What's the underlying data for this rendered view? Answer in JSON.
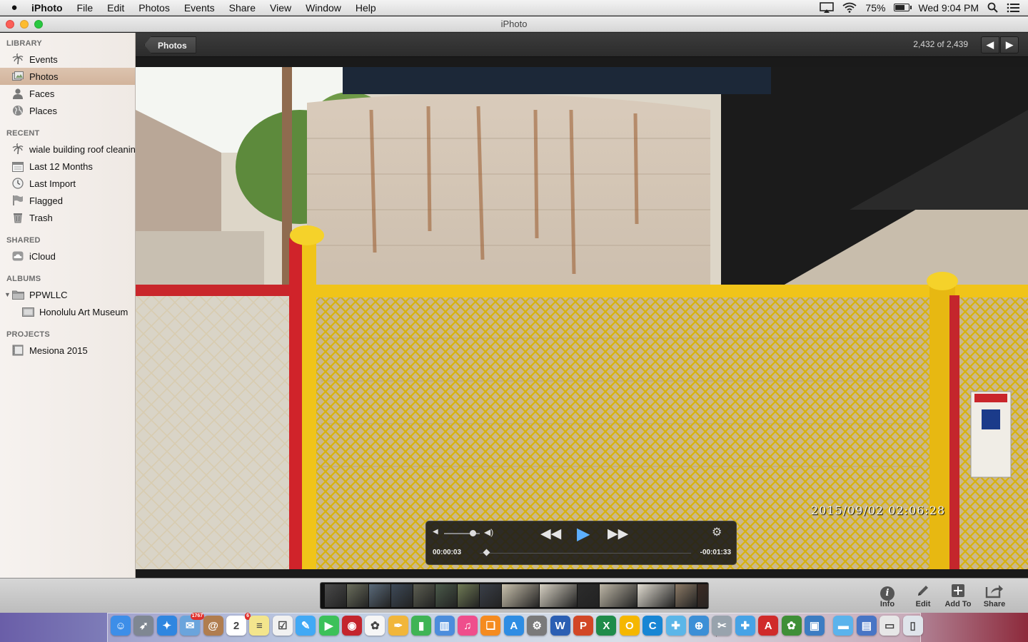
{
  "menubar": {
    "apple_icon": "apple-logo-icon",
    "items": [
      "iPhoto",
      "File",
      "Edit",
      "Photos",
      "Events",
      "Share",
      "View",
      "Window",
      "Help"
    ],
    "battery_percent": "75%",
    "battery_level": 0.75,
    "clock": "Wed 9:04 PM"
  },
  "window": {
    "title": "iPhoto"
  },
  "sidebar": {
    "sections": [
      {
        "header": "LIBRARY",
        "items": [
          {
            "label": "Events",
            "icon": "palm-tree-icon"
          },
          {
            "label": "Photos",
            "icon": "photos-icon",
            "selected": true
          },
          {
            "label": "Faces",
            "icon": "person-icon"
          },
          {
            "label": "Places",
            "icon": "globe-icon"
          }
        ]
      },
      {
        "header": "RECENT",
        "items": [
          {
            "label": "wiale building roof cleaning",
            "icon": "palm-tree-icon"
          },
          {
            "label": "Last 12 Months",
            "icon": "calendar-icon"
          },
          {
            "label": "Last Import",
            "icon": "clock-icon"
          },
          {
            "label": "Flagged",
            "icon": "flag-icon"
          },
          {
            "label": "Trash",
            "icon": "trash-icon"
          }
        ]
      },
      {
        "header": "SHARED",
        "items": [
          {
            "label": "iCloud",
            "icon": "icloud-icon"
          }
        ]
      },
      {
        "header": "ALBUMS",
        "items": [
          {
            "label": "PPWLLC",
            "icon": "folder-icon",
            "expanded": true
          },
          {
            "label": "Honolulu Art Museum",
            "icon": "album-icon",
            "indent": true
          }
        ]
      },
      {
        "header": "PROJECTS",
        "items": [
          {
            "label": "Mesiona 2015",
            "icon": "book-icon"
          }
        ]
      }
    ]
  },
  "toolbar": {
    "back_label": "Photos",
    "counter": "2,432 of 2,439",
    "prev_icon": "arrow-left-icon",
    "next_icon": "arrow-right-icon"
  },
  "viewer": {
    "timestamp": "2015/09/02  02:06:28",
    "hud": {
      "elapsed": "00:00:03",
      "remaining": "-00:01:33",
      "volume_level": 0.8,
      "playback_progress": 0.03
    }
  },
  "bottombar": {
    "buttons": [
      {
        "label": "Info",
        "icon": "info-icon"
      },
      {
        "label": "Edit",
        "icon": "pencil-icon"
      },
      {
        "label": "Add To",
        "icon": "plus-icon"
      },
      {
        "label": "Share",
        "icon": "share-icon"
      }
    ],
    "filmstrip_count": 16,
    "filmstrip_selected_index": 15
  },
  "dock": {
    "apps": [
      {
        "name": "finder-icon",
        "color": "#3d8ee8",
        "glyph": "☺"
      },
      {
        "name": "launchpad-icon",
        "color": "#7f8792",
        "glyph": "➶"
      },
      {
        "name": "safari-icon",
        "color": "#2f86e0",
        "glyph": "✦"
      },
      {
        "name": "mail-icon",
        "color": "#6aa4dc",
        "glyph": "✉",
        "badge": "1767"
      },
      {
        "name": "contacts-icon",
        "color": "#b07d4f",
        "glyph": "@"
      },
      {
        "name": "calendar-icon",
        "color": "#ffffff",
        "glyph": "2",
        "badge": "6"
      },
      {
        "name": "notes-icon",
        "color": "#f3e58d",
        "glyph": "≡"
      },
      {
        "name": "reminders-icon",
        "color": "#f1f1f1",
        "glyph": "☑"
      },
      {
        "name": "messages-icon",
        "color": "#41a9f5",
        "glyph": "✎"
      },
      {
        "name": "facetime-icon",
        "color": "#3cc15a",
        "glyph": "▶"
      },
      {
        "name": "photo-booth-icon",
        "color": "#c4252d",
        "glyph": "◉"
      },
      {
        "name": "photos-app-icon",
        "color": "#f6f6f6",
        "glyph": "✿"
      },
      {
        "name": "pages-icon",
        "color": "#f1b63a",
        "glyph": "✒"
      },
      {
        "name": "numbers-icon",
        "color": "#3fb455",
        "glyph": "▮"
      },
      {
        "name": "keynote-icon",
        "color": "#4c8ddc",
        "glyph": "▥"
      },
      {
        "name": "itunes-icon",
        "color": "#ef4e8c",
        "glyph": "♫"
      },
      {
        "name": "ibooks-icon",
        "color": "#f58b1f",
        "glyph": "❑"
      },
      {
        "name": "app-store-icon",
        "color": "#2e8de3",
        "glyph": "A"
      },
      {
        "name": "system-preferences-icon",
        "color": "#7a7a7a",
        "glyph": "⚙"
      },
      {
        "name": "word-icon",
        "color": "#2b5fb3",
        "glyph": "W"
      },
      {
        "name": "powerpoint-icon",
        "color": "#d24726",
        "glyph": "P"
      },
      {
        "name": "excel-icon",
        "color": "#1f8c4a",
        "glyph": "X"
      },
      {
        "name": "outlook-icon",
        "color": "#f5b700",
        "glyph": "O"
      },
      {
        "name": "ccleaner-icon",
        "color": "#1786d4",
        "glyph": "C"
      },
      {
        "name": "messenger-icon",
        "color": "#5bb6e8",
        "glyph": "✚"
      },
      {
        "name": "network-icon",
        "color": "#3c8fd6",
        "glyph": "⊕"
      },
      {
        "name": "utilities-icon",
        "color": "#98a3ad",
        "glyph": "✂"
      },
      {
        "name": "lync-icon",
        "color": "#46a3e6",
        "glyph": "✚"
      },
      {
        "name": "acrobat-icon",
        "color": "#d02a2a",
        "glyph": "A"
      },
      {
        "name": "iphoto-icon",
        "color": "#3f8f37",
        "glyph": "✿"
      },
      {
        "name": "preview-icon",
        "color": "#3c7cc2",
        "glyph": "▣"
      },
      {
        "name": "downloads-folder-icon",
        "color": "#5bb3ec",
        "glyph": "▬"
      },
      {
        "name": "documents-stack-icon",
        "color": "#4875c5",
        "glyph": "▤"
      },
      {
        "name": "stickies-icon",
        "color": "#e7e7e7",
        "glyph": "▭"
      },
      {
        "name": "dock-trash-icon",
        "color": "#dfe4ea",
        "glyph": "▯"
      }
    ]
  }
}
